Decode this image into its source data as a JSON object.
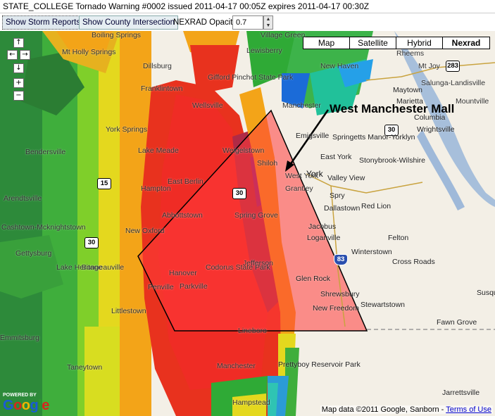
{
  "title": "STATE_COLLEGE Tornado Warning #0002 issued 2011-04-17 00:05Z expires 2011-04-17 00:30Z",
  "toolbar": {
    "storm_reports_label": "Show Storm Reports",
    "county_intersection_label": "Show County Intersection",
    "opacity_label": "NEXRAD Opacity",
    "opacity_value": "0.7"
  },
  "nav": {
    "up": "↑",
    "left": "←",
    "right": "→",
    "down": "↓",
    "zoom_in": "+",
    "zoom_out": "−"
  },
  "map_types": [
    "Map",
    "Satellite",
    "Hybrid",
    "Nexrad"
  ],
  "map_types_active": "Nexrad",
  "annotation": "West Manchester Mall",
  "shields": [
    "283",
    "30",
    "15",
    "30",
    "30",
    "83"
  ],
  "towns": [
    "Village Green",
    "Boiling Springs",
    "Mt Holly Springs",
    "Lewisberry",
    "Dillsburg",
    "Mt Joy",
    "Salunga-Landisville",
    "Rheems",
    "New Haven",
    "Gifford Pinchot State Park",
    "Maytown",
    "Marietta",
    "Columbia",
    "Mountville",
    "Franklintown",
    "Wellsville",
    "Manchester",
    "Emigsville",
    "Springetts Manor-Yorklyn",
    "Wrightsville",
    "York Springs",
    "Bendersville",
    "Lake Meade",
    "Weigelstown",
    "Shiloh",
    "East York",
    "Stonybrook-Wilshire",
    "West York",
    "York",
    "Valley View",
    "Hampton",
    "East Berlin",
    "Grantley",
    "Spry",
    "Arendtsville",
    "Dallastown",
    "Red Lion",
    "Cashtown-Mcknightstown",
    "Abbottstown",
    "Spring Grove",
    "New Oxford",
    "Jacobus",
    "Loganville",
    "Felton",
    "Gettysburg",
    "Winterstown",
    "Cross Roads",
    "Bonneauville",
    "Lake Heritage",
    "Jefferson",
    "Hanover",
    "Codorus State Park",
    "Glen Rock",
    "Penville",
    "Parkville",
    "Shrewsbury",
    "Susquehanna",
    "Stewartstown",
    "New Freedom",
    "Littlestown",
    "Fawn Grove",
    "Emmitsburg",
    "Taneytown",
    "Lineboro",
    "Prettyboy Reservoir Park",
    "Manchester",
    "Hampstead",
    "Jarrettsville"
  ],
  "copyright": "Map data ©2011 Google, Sanborn - ",
  "terms": "Terms of Use",
  "powered_by": "POWERED BY",
  "google_logo": "Google"
}
